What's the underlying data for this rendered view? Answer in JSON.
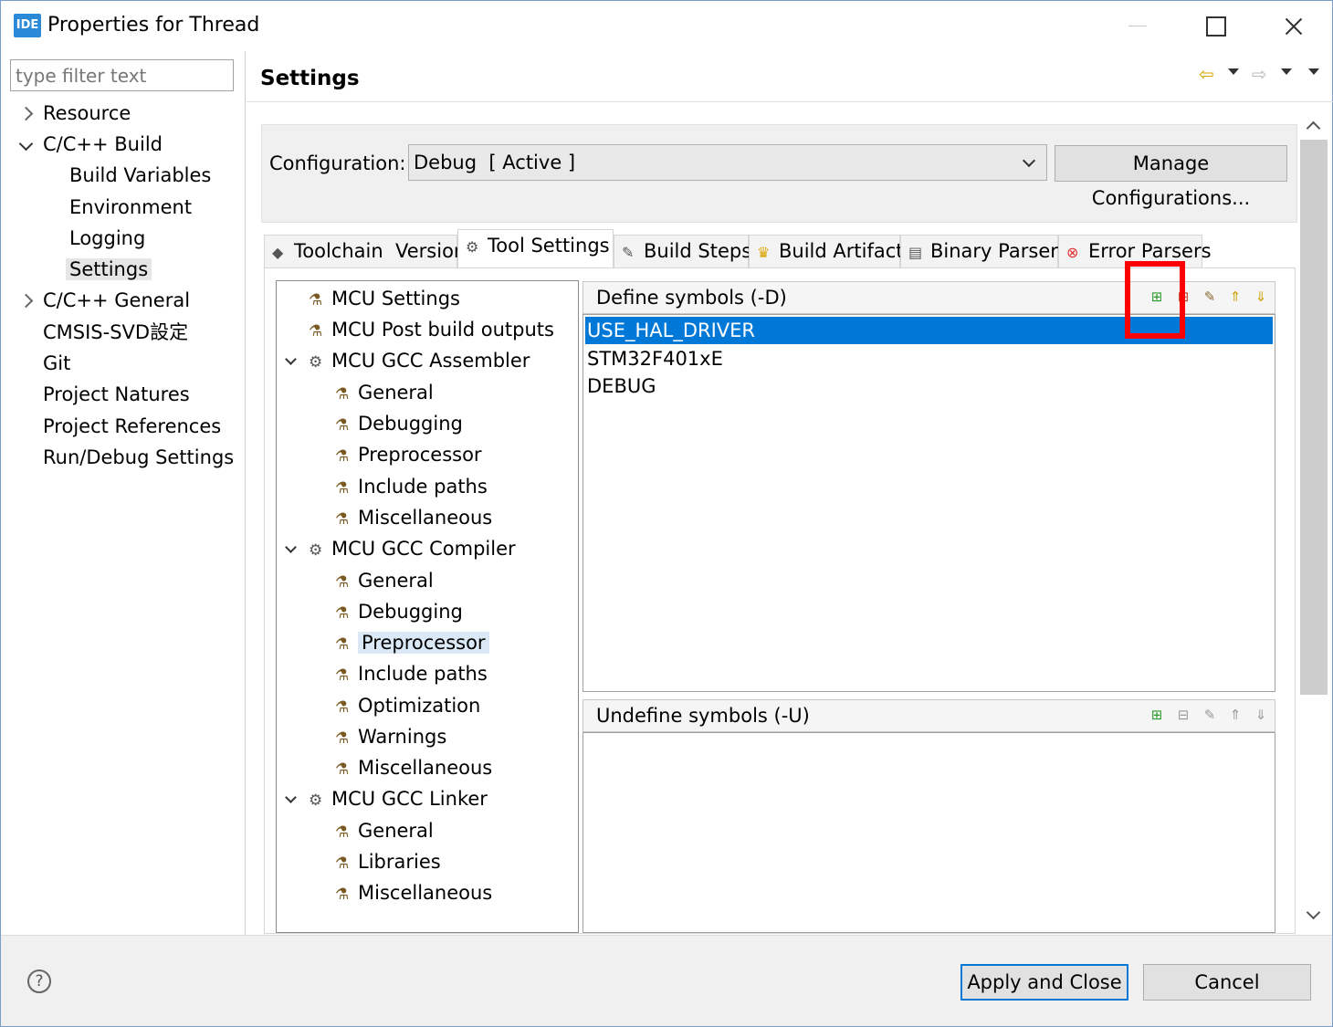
{
  "window": {
    "icon_text": "IDE",
    "title": "Properties for Thread"
  },
  "filter": {
    "placeholder": "type filter text"
  },
  "nav": {
    "items": [
      {
        "label": "Resource"
      },
      {
        "label": "C/C++ Build"
      },
      {
        "label": "Build Variables"
      },
      {
        "label": "Environment"
      },
      {
        "label": "Logging"
      },
      {
        "label": "Settings"
      },
      {
        "label": "C/C++ General"
      },
      {
        "label": "CMSIS-SVD設定"
      },
      {
        "label": "Git"
      },
      {
        "label": "Project Natures"
      },
      {
        "label": "Project References"
      },
      {
        "label": "Run/Debug Settings"
      }
    ],
    "selected": "Settings"
  },
  "page": {
    "heading": "Settings"
  },
  "config": {
    "label": "Configuration:",
    "value": "Debug  [ Active ]",
    "manage_label": "Manage Configurations..."
  },
  "tabs": [
    {
      "label": "Toolchain  Version",
      "icon": "chip-icon"
    },
    {
      "label": "Tool Settings",
      "icon": "gear-icon"
    },
    {
      "label": "Build Steps",
      "icon": "wrench-icon"
    },
    {
      "label": "Build Artifact",
      "icon": "trophy-icon"
    },
    {
      "label": "Binary Parsers",
      "icon": "binary-icon"
    },
    {
      "label": "Error Parsers",
      "icon": "error-icon"
    }
  ],
  "active_tab": "Tool Settings",
  "tool_tree": [
    {
      "label": "MCU Settings"
    },
    {
      "label": "MCU Post build outputs"
    },
    {
      "label": "MCU GCC Assembler"
    },
    {
      "label": "General"
    },
    {
      "label": "Debugging"
    },
    {
      "label": "Preprocessor"
    },
    {
      "label": "Include paths"
    },
    {
      "label": "Miscellaneous"
    },
    {
      "label": "MCU GCC Compiler"
    },
    {
      "label": "General"
    },
    {
      "label": "Debugging"
    },
    {
      "label": "Preprocessor"
    },
    {
      "label": "Include paths"
    },
    {
      "label": "Optimization"
    },
    {
      "label": "Warnings"
    },
    {
      "label": "Miscellaneous"
    },
    {
      "label": "MCU GCC Linker"
    },
    {
      "label": "General"
    },
    {
      "label": "Libraries"
    },
    {
      "label": "Miscellaneous"
    }
  ],
  "define_symbols": {
    "header": "Define symbols (-D)",
    "items": [
      "USE_HAL_DRIVER",
      "STM32F401xE",
      "DEBUG"
    ],
    "selected": "USE_HAL_DRIVER"
  },
  "undefine_symbols": {
    "header": "Undefine symbols (-U)",
    "items": []
  },
  "toolbar_icons": [
    "add-icon",
    "delete-icon",
    "edit-icon",
    "move-up-icon",
    "move-down-icon"
  ],
  "footer": {
    "help": "?",
    "apply_close": "Apply and Close",
    "cancel": "Cancel"
  },
  "colors": {
    "selection": "#0078d7",
    "highlight_box": "#ff0000"
  }
}
